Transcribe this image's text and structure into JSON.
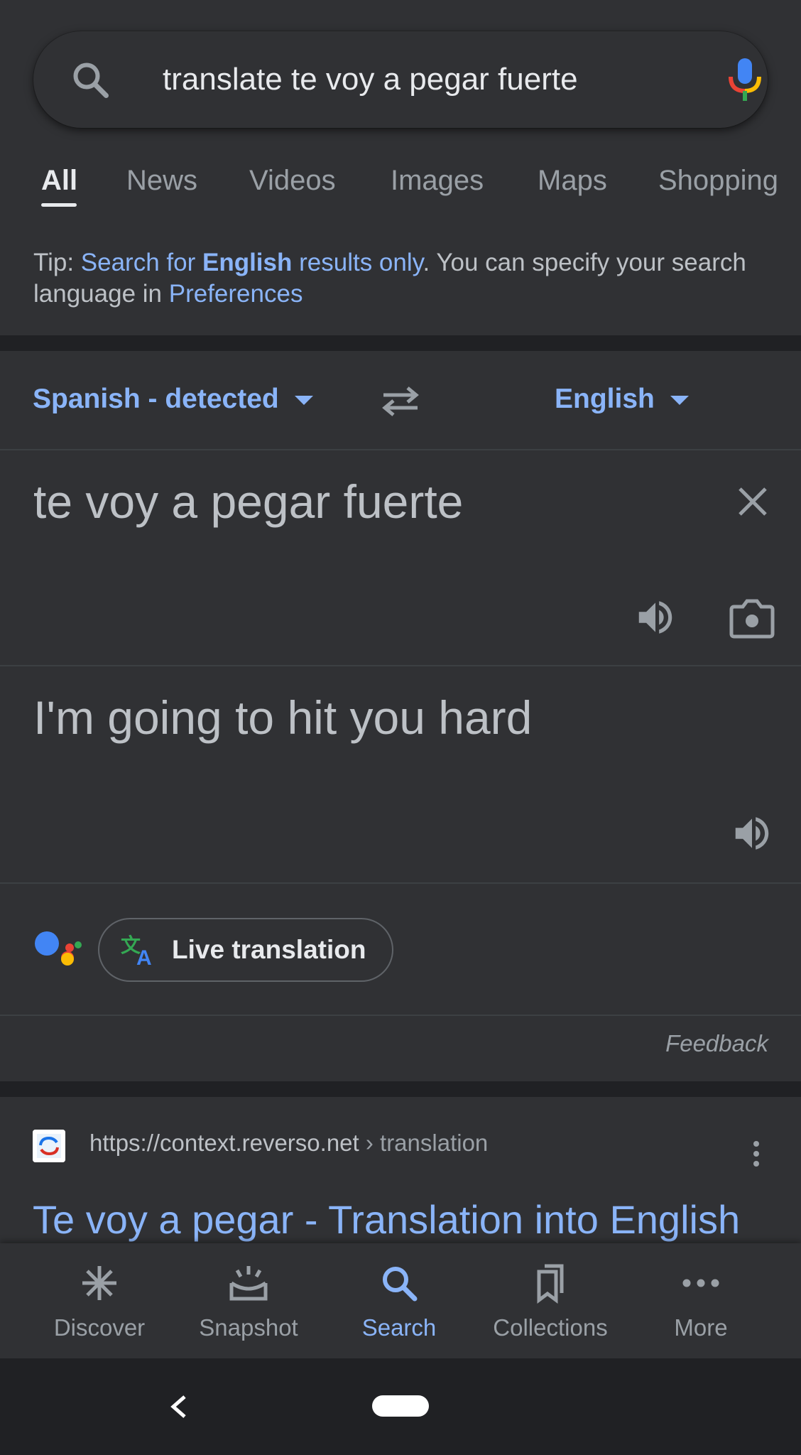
{
  "search": {
    "query": "translate te voy a pegar fuerte",
    "search_icon": "search-icon",
    "mic_icon": "mic-icon"
  },
  "tabs": [
    {
      "label": "All",
      "active": true
    },
    {
      "label": "News"
    },
    {
      "label": "Videos"
    },
    {
      "label": "Images"
    },
    {
      "label": "Maps"
    },
    {
      "label": "Shopping"
    }
  ],
  "tip": {
    "prefix": "Tip: ",
    "link1": "Search for ",
    "link_bold": "English",
    "link2": " results only",
    "middle": ". You can specify your search language in ",
    "pref_link": "Preferences"
  },
  "translate": {
    "source_lang": "Spanish - detected",
    "target_lang": "English",
    "source_text": "te voy a pegar fuerte",
    "target_text": "I'm going to hit you hard",
    "live_translation": "Live translation",
    "feedback": "Feedback"
  },
  "result": {
    "url": "https://context.reverso.net",
    "crumb": " › translation",
    "title": "Te voy a pegar - Translation into English"
  },
  "bottom_nav": [
    {
      "label": "Discover",
      "icon": "asterisk-icon"
    },
    {
      "label": "Snapshot",
      "icon": "snapshot-icon"
    },
    {
      "label": "Search",
      "icon": "search-icon",
      "active": true
    },
    {
      "label": "Collections",
      "icon": "collections-icon"
    },
    {
      "label": "More",
      "icon": "more-icon"
    }
  ],
  "colors": {
    "background": "#303134",
    "link": "#8ab4f8",
    "text": "#bdc1c6",
    "divider": "#202124"
  }
}
